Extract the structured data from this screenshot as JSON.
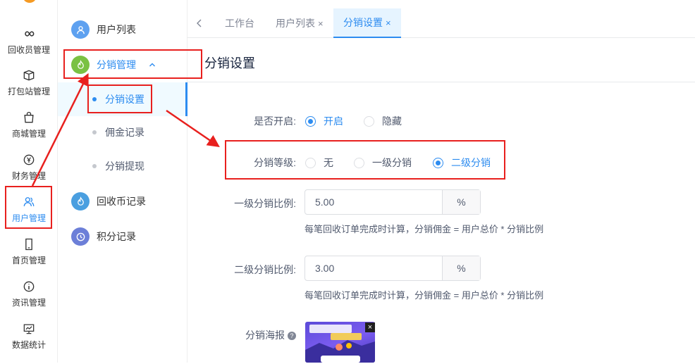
{
  "rail": {
    "items": [
      {
        "label": "回收员管理",
        "icon": "infinity-icon"
      },
      {
        "label": "打包站管理",
        "icon": "box-icon"
      },
      {
        "label": "商城管理",
        "icon": "shopping-bag-icon"
      },
      {
        "label": "财务管理",
        "icon": "yen-icon"
      },
      {
        "label": "用户管理",
        "icon": "users-icon"
      },
      {
        "label": "首页管理",
        "icon": "phone-icon"
      },
      {
        "label": "资讯管理",
        "icon": "info-icon"
      },
      {
        "label": "数据统计",
        "icon": "chart-icon"
      }
    ]
  },
  "submenu": {
    "user_list": "用户列表",
    "distribution_mgmt": "分销管理",
    "distribution_settings": "分销设置",
    "commission_records": "佣金记录",
    "distribution_withdraw": "分销提现",
    "coin_records": "回收币记录",
    "points_records": "积分记录"
  },
  "tabs": {
    "workbench": "工作台",
    "user_list": "用户列表",
    "distribution_settings": "分销设置",
    "close": "×"
  },
  "page": {
    "title": "分销设置",
    "enable_label": "是否开启:",
    "enable_on": "开启",
    "enable_off": "隐藏",
    "level_label": "分销等级:",
    "level_none": "无",
    "level_one": "一级分销",
    "level_two": "二级分销",
    "ratio1_label": "一级分销比例:",
    "ratio1_value": "5.00",
    "ratio2_label": "二级分销比例:",
    "ratio2_value": "3.00",
    "percent": "%",
    "hint": "每笔回收订单完成时计算，分销佣金 = 用户总价 * 分销比例",
    "poster_label": "分销海报",
    "help": "?",
    "poster_close": "×"
  },
  "colors": {
    "accent": "#2d8cf0",
    "annotation": "#e8201e",
    "green": "#7ac143",
    "user_icon_bg": "#5ea1f0",
    "coin_icon_bg": "#4a9fe0",
    "points_icon_bg": "#6c7fd8"
  }
}
